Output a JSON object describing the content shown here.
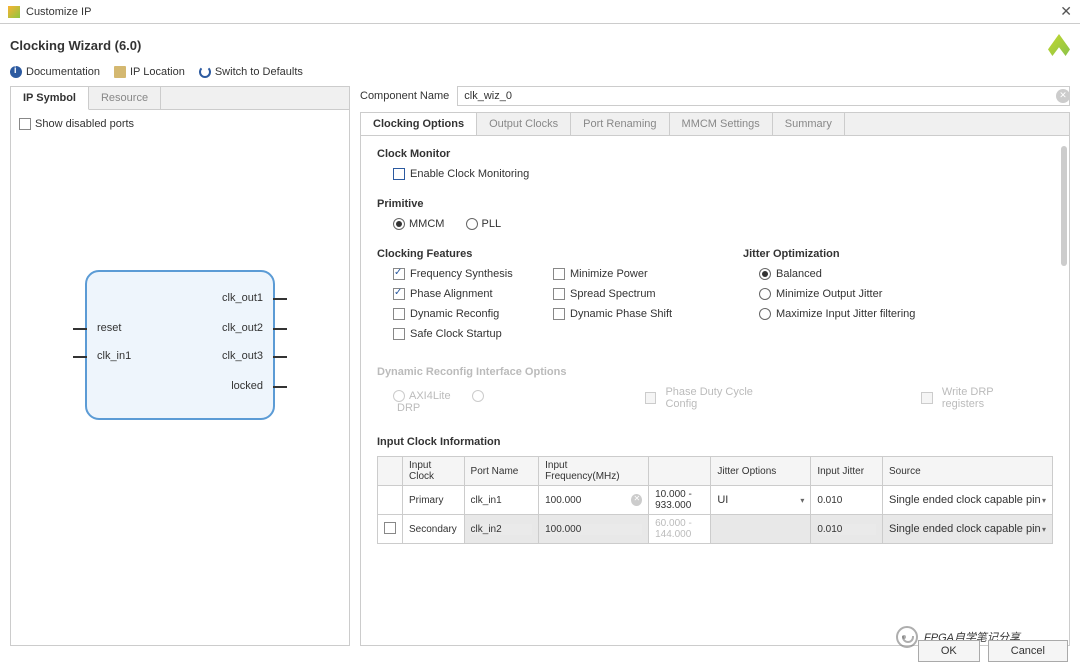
{
  "titlebar": {
    "title": "Customize IP",
    "close": "✕"
  },
  "header": {
    "title": "Clocking Wizard (6.0)"
  },
  "toolbar": {
    "doc": "Documentation",
    "loc": "IP Location",
    "reset": "Switch to Defaults"
  },
  "left": {
    "tabs": [
      "IP Symbol",
      "Resource"
    ],
    "show_disabled": "Show disabled ports",
    "ports_left": [
      "reset",
      "clk_in1"
    ],
    "ports_right": [
      "clk_out1",
      "clk_out2",
      "clk_out3",
      "locked"
    ]
  },
  "comp": {
    "label": "Component Name",
    "value": "clk_wiz_0"
  },
  "rtabs": [
    "Clocking Options",
    "Output Clocks",
    "Port Renaming",
    "MMCM Settings",
    "Summary"
  ],
  "clock_monitor": {
    "title": "Clock Monitor",
    "enable": "Enable Clock Monitoring"
  },
  "primitive": {
    "title": "Primitive",
    "opts": [
      "MMCM",
      "PLL"
    ],
    "sel": "MMCM"
  },
  "features": {
    "title": "Clocking Features",
    "items": [
      {
        "l": "Frequency Synthesis",
        "c": true
      },
      {
        "l": "Minimize Power",
        "c": false
      },
      {
        "l": "Phase Alignment",
        "c": true
      },
      {
        "l": "Spread Spectrum",
        "c": false
      },
      {
        "l": "Dynamic Reconfig",
        "c": false
      },
      {
        "l": "Dynamic Phase Shift",
        "c": false
      },
      {
        "l": "Safe Clock Startup",
        "c": false
      }
    ]
  },
  "jitter": {
    "title": "Jitter Optimization",
    "opts": [
      "Balanced",
      "Minimize Output Jitter",
      "Maximize Input Jitter filtering"
    ],
    "sel": "Balanced"
  },
  "dynrec": {
    "title": "Dynamic Reconfig Interface Options",
    "opts": [
      "AXI4Lite",
      "DRP"
    ],
    "phase": "Phase Duty Cycle Config",
    "write": "Write DRP registers"
  },
  "clk_info": {
    "title": "Input Clock Information",
    "headers": [
      "",
      "Input Clock",
      "Port Name",
      "Input Frequency(MHz)",
      "",
      "Jitter Options",
      "Input Jitter",
      "Source"
    ],
    "rows": [
      {
        "en": true,
        "clk": "Primary",
        "port": "clk_in1",
        "freq": "100.000",
        "range": "10.000 - 933.000",
        "jo": "UI",
        "ij": "0.010",
        "src": "Single ended clock capable pin"
      },
      {
        "en": false,
        "clk": "Secondary",
        "port": "clk_in2",
        "freq": "100.000",
        "range": "60.000 - 144.000",
        "jo": "",
        "ij": "0.010",
        "src": "Single ended clock capable pin"
      }
    ]
  },
  "buttons": {
    "ok": "OK",
    "cancel": "Cancel"
  },
  "watermark": "FPGA自学笔记分享"
}
